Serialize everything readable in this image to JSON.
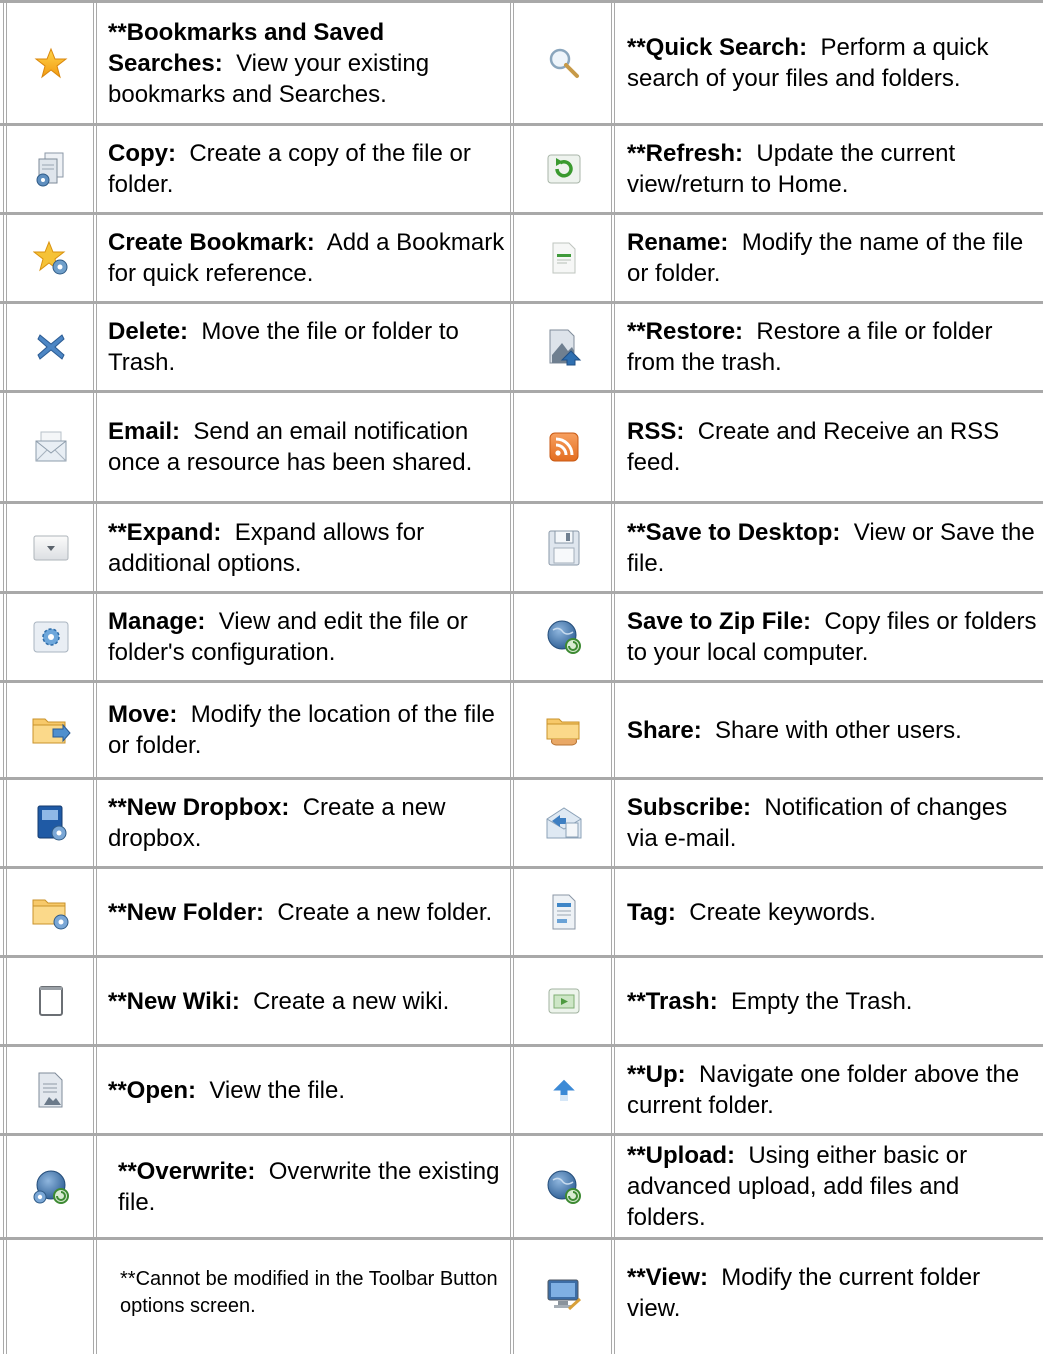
{
  "rows": [
    {
      "left": {
        "icon": "star-icon",
        "bold": "**Bookmarks and Saved Searches:",
        "desc": "View your existing bookmarks and Searches."
      },
      "right": {
        "icon": "magnifier-icon",
        "bold": "**Quick Search:",
        "desc": "Perform a quick search of your files and folders."
      }
    },
    {
      "left": {
        "icon": "copy-icon",
        "bold": "Copy:",
        "desc": "Create a copy of the file or folder."
      },
      "right": {
        "icon": "refresh-icon",
        "bold": "**Refresh:",
        "desc": "Update the current view/return to Home."
      }
    },
    {
      "left": {
        "icon": "create-bookmark-icon",
        "bold": "Create Bookmark:",
        "desc": "Add a Bookmark for quick reference."
      },
      "right": {
        "icon": "rename-icon",
        "bold": "Rename:",
        "desc": "Modify the name of the file or folder."
      }
    },
    {
      "left": {
        "icon": "delete-icon",
        "bold": "Delete:",
        "desc": "Move the file or folder to Trash."
      },
      "right": {
        "icon": "restore-icon",
        "bold": "**Restore:",
        "desc": "Restore a file or folder from the trash."
      }
    },
    {
      "left": {
        "icon": "email-icon",
        "bold": "Email:",
        "desc": "Send an email notification once a resource has been shared."
      },
      "right": {
        "icon": "rss-icon",
        "bold": "RSS:",
        "desc": "Create and Receive an RSS feed."
      }
    },
    {
      "left": {
        "icon": "expand-icon",
        "bold": "**Expand:",
        "desc": "Expand allows for additional options."
      },
      "right": {
        "icon": "save-to-desktop-icon",
        "bold": "**Save to Desktop:",
        "desc": "View or Save the file."
      }
    },
    {
      "left": {
        "icon": "manage-gear-icon",
        "bold": "Manage:",
        "desc": "View and edit the file or folder's configuration."
      },
      "right": {
        "icon": "save-zip-globe-icon",
        "bold": "Save to Zip File:",
        "desc": "Copy files or folders to your local computer."
      }
    },
    {
      "left": {
        "icon": "move-folder-icon",
        "bold": "Move:",
        "desc": "Modify the location of the file or folder."
      },
      "right": {
        "icon": "share-folder-icon",
        "bold": "Share:",
        "desc": "Share with other users."
      }
    },
    {
      "left": {
        "icon": "new-dropbox-icon",
        "bold": "**New Dropbox:",
        "desc": "Create a new dropbox."
      },
      "right": {
        "icon": "subscribe-mail-icon",
        "bold": "Subscribe:",
        "desc": "Notification of changes via e-mail."
      }
    },
    {
      "left": {
        "icon": "new-folder-icon",
        "bold": "**New Folder:",
        "desc": "Create a new folder."
      },
      "right": {
        "icon": "tag-icon",
        "bold": "Tag:",
        "desc": "Create keywords."
      }
    },
    {
      "left": {
        "icon": "new-wiki-icon",
        "bold": "**New Wiki:",
        "desc": "Create a new wiki."
      },
      "right": {
        "icon": "trash-icon",
        "bold": "**Trash:",
        "desc": "Empty the Trash."
      }
    },
    {
      "left": {
        "icon": "open-file-icon",
        "bold": "**Open:",
        "desc": "View the file."
      },
      "right": {
        "icon": "up-arrow-icon",
        "bold": "**Up:",
        "desc": "Navigate one folder above the current folder."
      }
    },
    {
      "left": {
        "icon": "overwrite-globe-icon",
        "bold": "**Overwrite:",
        "desc": "Overwrite the existing file."
      },
      "right": {
        "icon": "upload-globe-icon",
        "bold": "**Upload:",
        "desc": "Using either basic or advanced upload, add files and folders."
      }
    },
    {
      "left": {
        "icon": "",
        "bold": "",
        "desc": "**Cannot be modified in the Toolbar Button options screen."
      },
      "right": {
        "icon": "view-monitor-icon",
        "bold": "**View:",
        "desc": "Modify the current folder view."
      }
    }
  ]
}
